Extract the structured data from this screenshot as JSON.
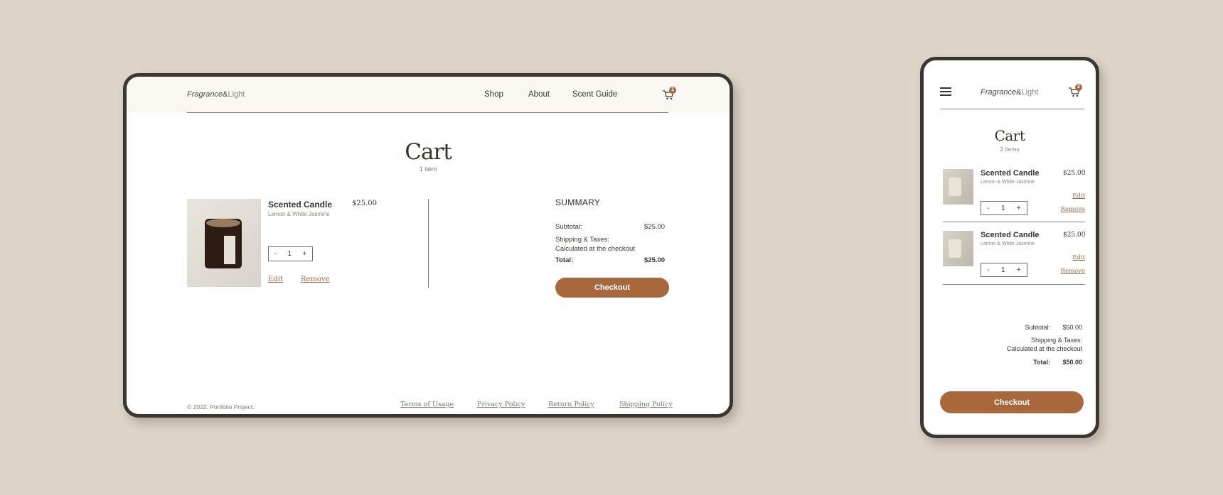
{
  "desktop": {
    "brand": {
      "italic": "Fragrance",
      "amp": "&",
      "light": "Light"
    },
    "nav": [
      "Shop",
      "About",
      "Scent Guide"
    ],
    "cart_badge": "1",
    "title": "Cart",
    "item_count": "1 item",
    "item": {
      "name": "Scented Candle",
      "variant": "Lemon & White Jasmine",
      "price": "$25.00",
      "qty_minus": "-",
      "qty": "1",
      "qty_plus": "+",
      "edit": "Edit",
      "remove": "Remove"
    },
    "summary": {
      "title": "SUMMARY",
      "subtotal_label": "Subtotal:",
      "subtotal": "$25.00",
      "shipping_label": "Shipping & Taxes:",
      "shipping_note": "Calculated at the checkout",
      "total_label": "Total:",
      "total": "$25.00",
      "checkout": "Checkout"
    },
    "footer": {
      "copyright": "© 2022. Portfolio Project.",
      "links": [
        "Terms of Usage",
        "Privacy Policy",
        "Return Policy",
        "Shipping Policy"
      ]
    }
  },
  "mobile": {
    "brand": {
      "italic": "Fragrance",
      "amp": "&",
      "light": "Light"
    },
    "cart_badge": "2",
    "title": "Cart",
    "item_count": "2 items",
    "items": [
      {
        "name": "Scented Candle",
        "variant": "Lemon & White Jasmine",
        "price": "$25.00",
        "qty_minus": "-",
        "qty": "1",
        "qty_plus": "+",
        "edit": "Edit",
        "remove": "Remove"
      },
      {
        "name": "Scented Candle",
        "variant": "Lemon & White Jasmine",
        "price": "$25.00",
        "qty_minus": "-",
        "qty": "1",
        "qty_plus": "+",
        "edit": "Edit",
        "remove": "Remove"
      }
    ],
    "summary": {
      "subtotal_label": "Subtotal:",
      "subtotal": "$50.00",
      "shipping_label": "Shipping & Taxes:",
      "shipping_note": "Calculated at the checkout",
      "total_label": "Total:",
      "total": "$50.00",
      "checkout": "Checkout"
    }
  },
  "colors": {
    "background": "#ded4c8",
    "accent": "#a9683c",
    "header": "#fbf7f2",
    "frame": "#3a3733"
  },
  "icons": [
    "cart-icon",
    "hamburger-icon"
  ]
}
